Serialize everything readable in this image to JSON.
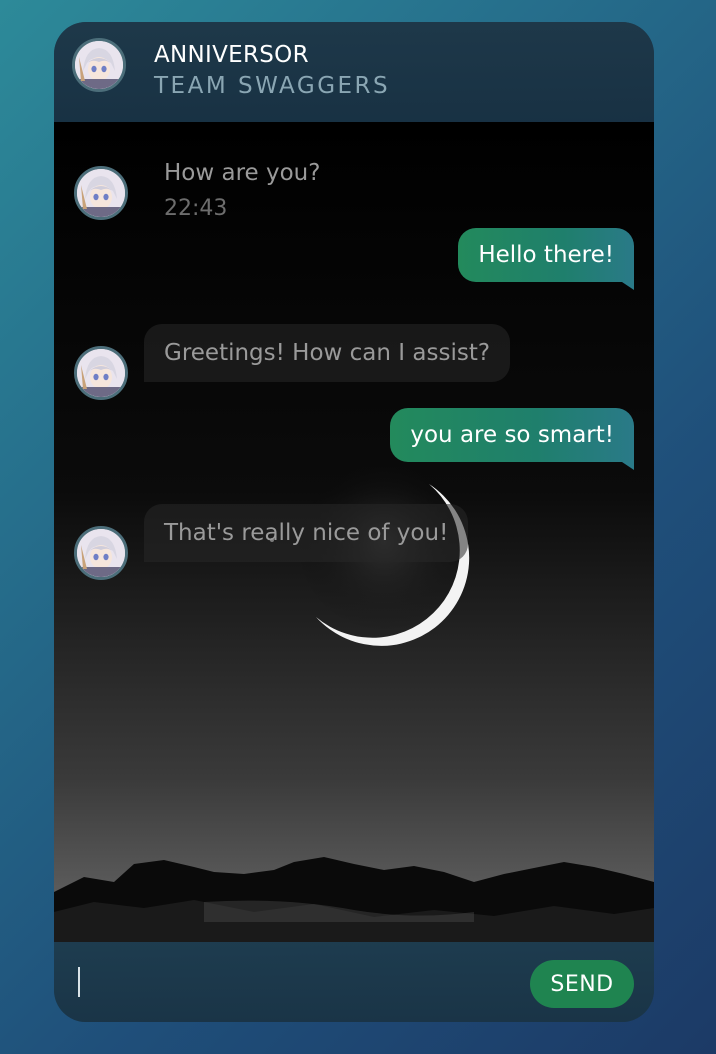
{
  "header": {
    "title": "ANNIVERSOR",
    "subtitle": "TEAM SWAGGERS"
  },
  "messages": [
    {
      "direction": "incoming",
      "text": "How are you?",
      "time": "22:43"
    },
    {
      "direction": "outgoing",
      "text": "Hello there!"
    },
    {
      "direction": "incoming",
      "text": "Greetings! How can I assist?"
    },
    {
      "direction": "outgoing",
      "text": "you are so smart!"
    },
    {
      "direction": "incoming",
      "text": "That's really nice of you!"
    }
  ],
  "composer": {
    "input_value": "",
    "send_label": "SEND"
  },
  "colors": {
    "accent": "#1f8450",
    "outgoing_bubble": "#238a5c",
    "background": "#266f8c"
  },
  "icons": {
    "avatar": "anime-avatar-icon"
  }
}
